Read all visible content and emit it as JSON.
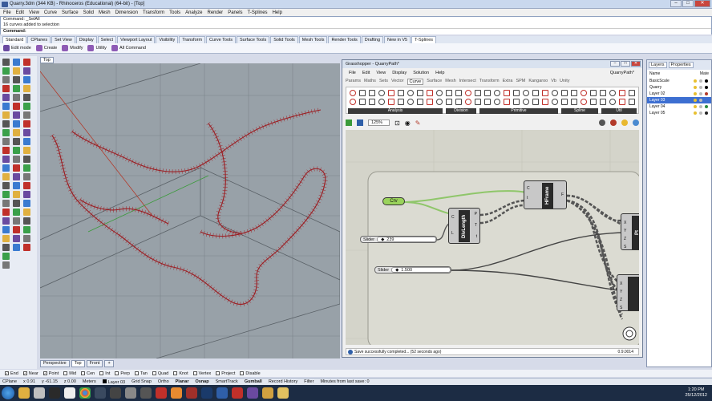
{
  "window": {
    "title": "Quarry.3dm (344 KB) - Rhinoceros (Educational) (64-bit) - [Top]"
  },
  "menu": [
    "File",
    "Edit",
    "View",
    "Curve",
    "Surface",
    "Solid",
    "Mesh",
    "Dimension",
    "Transform",
    "Tools",
    "Analyze",
    "Render",
    "Panels",
    "T-Splines",
    "Help"
  ],
  "command_history": [
    "Command: _SelAll",
    "16 curves added to selection"
  ],
  "command_prompt": "Command:",
  "toolbar_tabs": [
    "Standard",
    "CPlanes",
    "Set View",
    "Display",
    "Select",
    "Viewport Layout",
    "Visibility",
    "Transform",
    "Curve Tools",
    "Surface Tools",
    "Solid Tools",
    "Mesh Tools",
    "Render Tools",
    "Drafting",
    "New in V5",
    "T-Splines"
  ],
  "tsplines_toolbar": [
    "Edit mode",
    "Create",
    "Modify",
    "Utility",
    "All Command"
  ],
  "viewport": {
    "active_label": "Top",
    "bottom_tabs": [
      "Perspective",
      "Top",
      "Front",
      "+"
    ]
  },
  "grasshopper": {
    "title": "Grasshopper - QuarryPath*",
    "menu": [
      "File",
      "Edit",
      "View",
      "Display",
      "Solution",
      "Help"
    ],
    "file_name": "QuarryPath*",
    "tabs": [
      "Params",
      "Maths",
      "Sets",
      "Vector",
      "Curve",
      "Surface",
      "Mesh",
      "Intersect",
      "Transform",
      "Extra",
      "SPM",
      "Kangaroo",
      "Vb",
      "Unity"
    ],
    "active_tab": "Curve",
    "ribbon_groups": [
      "Analysis",
      "Division",
      "Primitive",
      "Spline",
      "Util"
    ],
    "zoom": "125%",
    "components": {
      "crv": "Crv",
      "divlength": "DivLength",
      "hframe": "HFrame",
      "pt": "Pt",
      "slider1": {
        "label": "Slider",
        "value": "239"
      },
      "slider2": {
        "label": "Slider",
        "value": "1.500"
      }
    },
    "status": "Save successfully completed... (52 seconds ago)",
    "version": "0.9.0014"
  },
  "layers": {
    "tabs": [
      "Layers",
      "Properties"
    ],
    "col_name": "Name",
    "col_mat": "Mate",
    "items": [
      {
        "name": "BasicScale",
        "color": "#000000",
        "selected": false
      },
      {
        "name": "Quarry",
        "color": "#000000",
        "selected": false
      },
      {
        "name": "Layer 02",
        "color": "#b43b2a",
        "selected": false
      },
      {
        "name": "Layer 03",
        "color": "#3d6fd1",
        "selected": true
      },
      {
        "name": "Layer 04",
        "color": "#2c8a3e",
        "selected": false
      },
      {
        "name": "Layer 05",
        "color": "#222222",
        "selected": false
      }
    ]
  },
  "osnaps": [
    {
      "label": "End",
      "checked": true
    },
    {
      "label": "Near",
      "checked": true
    },
    {
      "label": "Point",
      "checked": true
    },
    {
      "label": "Mid",
      "checked": false
    },
    {
      "label": "Cen",
      "checked": false
    },
    {
      "label": "Int",
      "checked": false
    },
    {
      "label": "Perp",
      "checked": false
    },
    {
      "label": "Tan",
      "checked": false
    },
    {
      "label": "Quad",
      "checked": false
    },
    {
      "label": "Knot",
      "checked": false
    },
    {
      "label": "Vertex",
      "checked": false
    },
    {
      "label": "Project",
      "checked": false
    },
    {
      "label": "Disable",
      "checked": false
    }
  ],
  "status": {
    "cplane": "CPlane",
    "x": "x 0.91",
    "y": "y -61.15",
    "z": "z 0.00",
    "units": "Meters",
    "layer": "Layer 03",
    "grid_snap": "Grid Snap",
    "ortho": "Ortho",
    "planar": "Planar",
    "osnap": "Osnap",
    "smarttrack": "SmartTrack",
    "gumball": "Gumball",
    "record_history": "Record History",
    "filter": "Filter",
    "minutes": "Minutes from last save: 0"
  },
  "clock": {
    "time": "1:20 PM",
    "date": "25/12/2012"
  }
}
